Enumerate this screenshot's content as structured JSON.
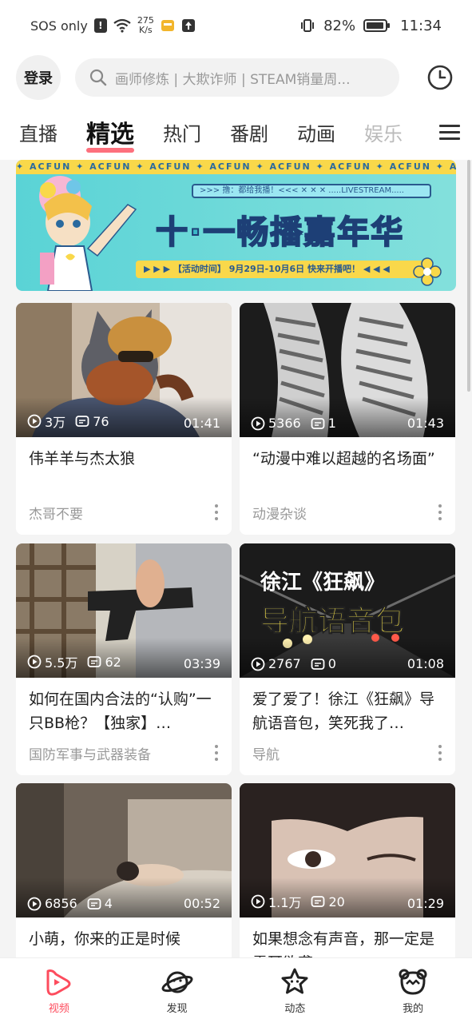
{
  "status_bar": {
    "carrier": "SOS only",
    "speed_value": "275",
    "speed_unit": "K/s",
    "battery": "82%",
    "time": "11:34"
  },
  "header": {
    "login_label": "登录",
    "search_placeholder": "画师修炼 | 大欺诈师 | STEAM销量周..."
  },
  "tabs": [
    {
      "label": "直播"
    },
    {
      "label": "精选"
    },
    {
      "label": "热门"
    },
    {
      "label": "番剧"
    },
    {
      "label": "动画"
    },
    {
      "label": "娱乐"
    }
  ],
  "banner": {
    "top_strip": "✦ ACFUN ✦ ACFUN ✦ ACFUN ✦ ACFUN ✦ ACFUN ✦ ACFUN ✦ ACFUN ✦ ACFUN ✦ ACFUN",
    "stream_strip": ">>> 撸：都给我播！<<<     ✕ ✕ ✕      .....LIVESTREAM.....",
    "title": "十·一畅播嘉年华",
    "bottom_strip": "▶ ▶ ▶   【活动时间】 9月29日-10月6日  快来开播吧！  ◀ ◀ ◀"
  },
  "cards": [
    {
      "plays": "3万",
      "comments": "76",
      "duration": "01:41",
      "title": "伟羊羊与杰太狼",
      "author": "杰哥不要"
    },
    {
      "plays": "5366",
      "comments": "1",
      "duration": "01:43",
      "title": "“动漫中难以超越的名场面”",
      "author": "动漫杂谈"
    },
    {
      "plays": "5.5万",
      "comments": "62",
      "duration": "03:39",
      "title": "如何在国内合法的“认购”一只BB枪？【独家】…",
      "author": "国防军事与武器装备"
    },
    {
      "plays": "2767",
      "comments": "0",
      "duration": "01:08",
      "title": "爱了爱了！徐江《狂飙》导航语音包，笑死我了…",
      "author": "导航",
      "overlay_line1": "徐江《狂飙》",
      "overlay_line2": "导航语音包"
    },
    {
      "plays": "6856",
      "comments": "4",
      "duration": "00:52",
      "title": "小萌，你来的正是时候",
      "author": ""
    },
    {
      "plays": "1.1万",
      "comments": "20",
      "duration": "01:29",
      "title": "如果想念有声音，那一定是震耳欲聋",
      "author": ""
    }
  ],
  "bottom_nav": [
    {
      "label": "视频",
      "icon": "video-icon",
      "active": true
    },
    {
      "label": "发现",
      "icon": "planet-icon",
      "active": false
    },
    {
      "label": "动态",
      "icon": "star-face-icon",
      "active": false
    },
    {
      "label": "我的",
      "icon": "bear-face-icon",
      "active": false
    }
  ],
  "colors": {
    "accent": "#fd4c5d",
    "banner_yellow": "#f9d84a",
    "banner_teal": "#5ad3d6"
  }
}
